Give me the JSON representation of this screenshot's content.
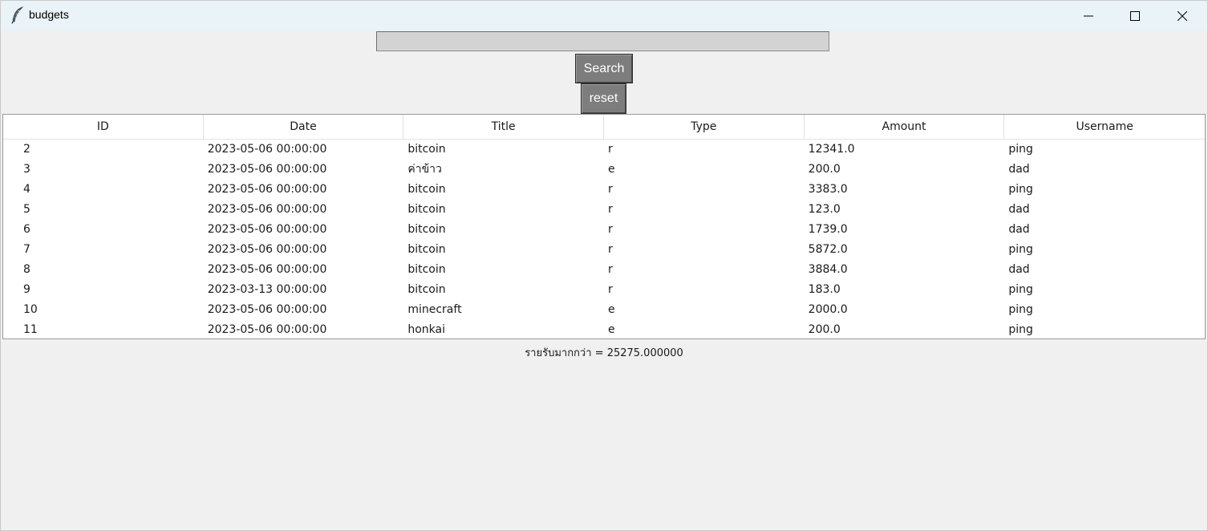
{
  "window": {
    "title": "budgets",
    "icons": {
      "app": "feather-icon",
      "minimize": "minimize-icon",
      "maximize": "maximize-icon",
      "close": "close-icon"
    }
  },
  "search": {
    "value": "",
    "button_label": "Search",
    "reset_label": "reset"
  },
  "table": {
    "columns": [
      "ID",
      "Date",
      "Title",
      "Type",
      "Amount",
      "Username"
    ],
    "rows": [
      [
        "2",
        "2023-05-06 00:00:00",
        "bitcoin",
        "r",
        "12341.0",
        "ping"
      ],
      [
        "3",
        "2023-05-06 00:00:00",
        "ค่าข้าว",
        "e",
        "200.0",
        "dad"
      ],
      [
        "4",
        "2023-05-06 00:00:00",
        "bitcoin",
        "r",
        "3383.0",
        "ping"
      ],
      [
        "5",
        "2023-05-06 00:00:00",
        "bitcoin",
        "r",
        "123.0",
        "dad"
      ],
      [
        "6",
        "2023-05-06 00:00:00",
        "bitcoin",
        "r",
        "1739.0",
        "dad"
      ],
      [
        "7",
        "2023-05-06 00:00:00",
        "bitcoin",
        "r",
        "5872.0",
        "ping"
      ],
      [
        "8",
        "2023-05-06 00:00:00",
        "bitcoin",
        "r",
        "3884.0",
        "dad"
      ],
      [
        "9",
        "2023-03-13 00:00:00",
        "bitcoin",
        "r",
        "183.0",
        "ping"
      ],
      [
        "10",
        "2023-05-06 00:00:00",
        "minecraft",
        "e",
        "2000.0",
        "ping"
      ],
      [
        "11",
        "2023-05-06 00:00:00",
        "honkai",
        "e",
        "200.0",
        "ping"
      ]
    ]
  },
  "summary": {
    "text": "รายรับมากกว่า = 25275.000000"
  },
  "colors": {
    "titlebar": "#eaf3f7",
    "button": "#7d7d7d",
    "background": "#f0f0f0",
    "entry": "#d3d3d3"
  }
}
